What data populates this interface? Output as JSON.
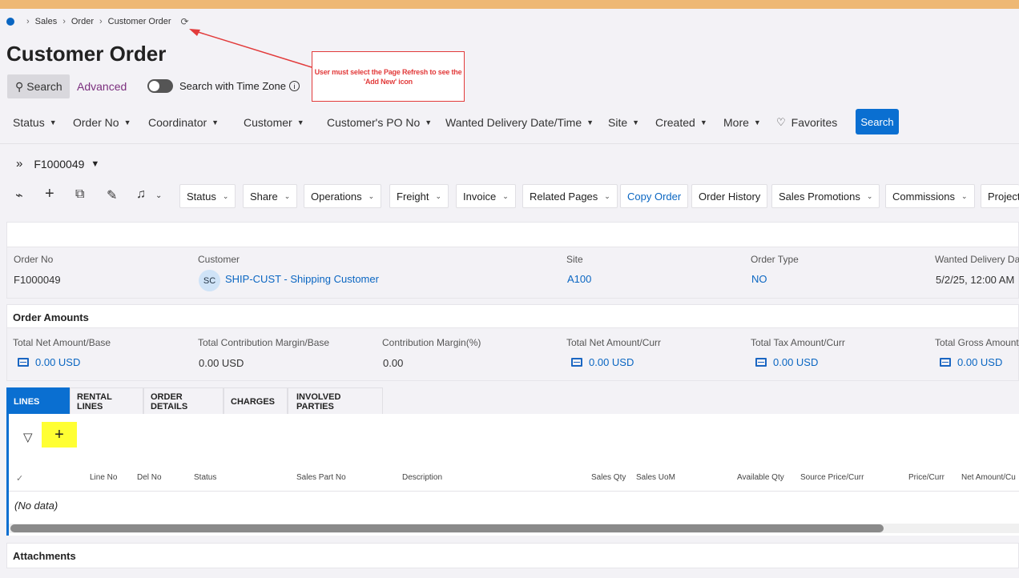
{
  "breadcrumb": {
    "items": [
      "Sales",
      "Order",
      "Customer Order"
    ]
  },
  "page": {
    "title": "Customer Order"
  },
  "search_bar": {
    "search_label": "Search",
    "advanced_label": "Advanced",
    "time_zone_label": "Search with Time Zone"
  },
  "annotation": {
    "text": "User must select the Page Refresh to see the 'Add New' icon"
  },
  "filters": {
    "items": [
      "Status",
      "Order No",
      "Coordinator",
      "Customer",
      "Customer's PO No",
      "Wanted Delivery Date/Time",
      "Site",
      "Created",
      "More"
    ],
    "favorites_label": "Favorites",
    "search_button": "Search"
  },
  "record": {
    "id": "F1000049"
  },
  "commands": [
    "Status",
    "Share",
    "Operations",
    "Freight",
    "Invoice",
    "Related Pages",
    "Copy Order",
    "Order History",
    "Sales Promotions",
    "Commissions",
    "Project"
  ],
  "header_fields": [
    {
      "label": "Order No",
      "value": "F1000049"
    },
    {
      "label": "Customer",
      "value": "SHIP-CUST - Shipping Customer",
      "avatar": "SC"
    },
    {
      "label": "Site",
      "value": "A100"
    },
    {
      "label": "Order Type",
      "value": "NO"
    },
    {
      "label": "Wanted Delivery Dat",
      "value": "5/2/25, 12:00 AM"
    }
  ],
  "order_amounts": {
    "title": "Order Amounts",
    "fields": [
      {
        "label": "Total Net Amount/Base",
        "value": "0.00 USD"
      },
      {
        "label": "Total Contribution Margin/Base",
        "value": "0.00 USD"
      },
      {
        "label": "Contribution Margin(%)",
        "value": "0.00"
      },
      {
        "label": "Total Net Amount/Curr",
        "value": "0.00 USD"
      },
      {
        "label": "Total Tax Amount/Curr",
        "value": "0.00 USD"
      },
      {
        "label": "Total Gross Amount",
        "value": "0.00 USD"
      }
    ]
  },
  "tabs": [
    "LINES",
    "RENTAL LINES",
    "ORDER DETAILS",
    "CHARGES",
    "INVOLVED PARTIES"
  ],
  "lines_table": {
    "columns": [
      "Line No",
      "Del No",
      "Status",
      "Sales Part No",
      "Description",
      "Sales Qty",
      "Sales UoM",
      "Available Qty",
      "Source Price/Curr",
      "Price/Curr",
      "Net Amount/Cu"
    ],
    "empty_text": "(No data)"
  },
  "attachments": {
    "title": "Attachments"
  },
  "colors": {
    "accent": "#0a6fd1",
    "top_bar": "#eeb874",
    "annotation": "#e23b3b",
    "highlight": "#ffff33"
  }
}
